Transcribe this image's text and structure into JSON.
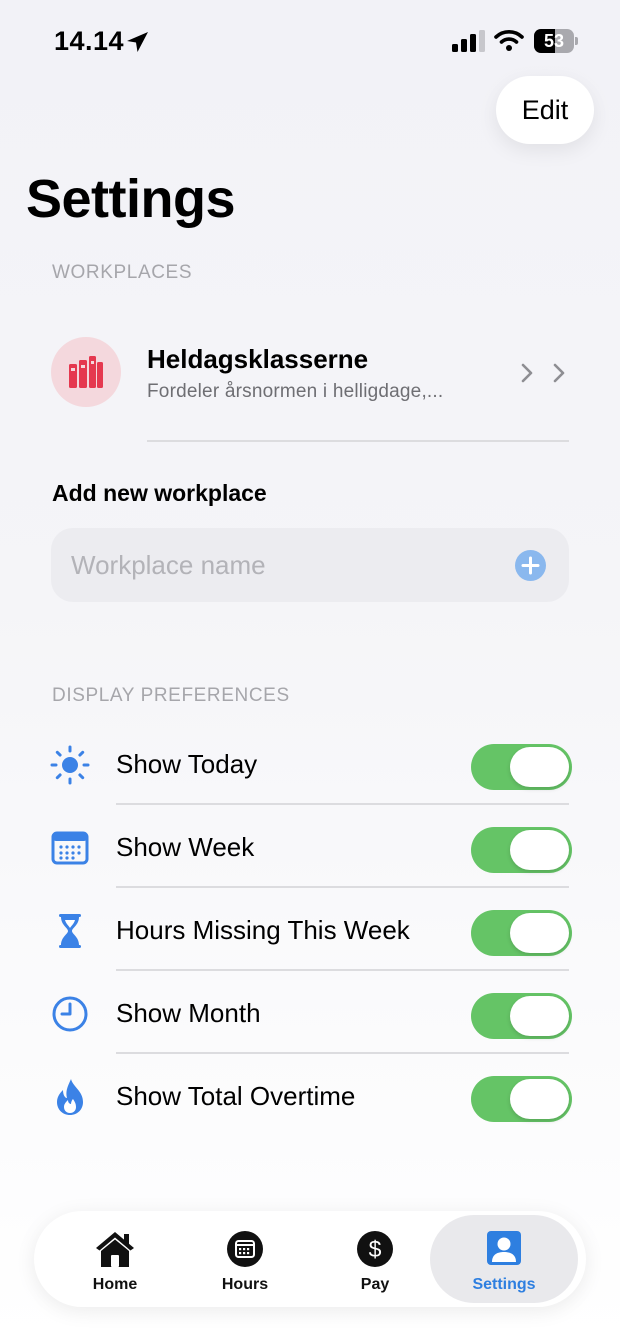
{
  "status_bar": {
    "time": "14.14",
    "battery": "53",
    "battery_level": 0.53
  },
  "header": {
    "edit_label": "Edit",
    "title": "Settings"
  },
  "workplaces": {
    "section_title": "WORKPLACES",
    "items": [
      {
        "name": "Heldagsklasserne",
        "subtitle": "Fordeler årsnormen i helligdage,...",
        "icon": "books-icon",
        "icon_color": "#e5384f"
      }
    ],
    "add_label": "Add new workplace",
    "input_placeholder": "Workplace name",
    "input_value": ""
  },
  "display_preferences": {
    "section_title": "DISPLAY PREFERENCES",
    "items": [
      {
        "label": "Show Today",
        "icon": "sun-icon",
        "enabled": true
      },
      {
        "label": "Show Week",
        "icon": "calendar-icon",
        "enabled": true
      },
      {
        "label": "Hours Missing This Week",
        "icon": "hourglass-icon",
        "enabled": true
      },
      {
        "label": "Show Month",
        "icon": "clock-icon",
        "enabled": true
      },
      {
        "label": "Show Total Overtime",
        "icon": "flame-icon",
        "enabled": true
      }
    ]
  },
  "tab_bar": {
    "tabs": [
      {
        "label": "Home",
        "icon": "house-icon",
        "active": false
      },
      {
        "label": "Hours",
        "icon": "calendar-circle-icon",
        "active": false
      },
      {
        "label": "Pay",
        "icon": "dollar-circle-icon",
        "active": false
      },
      {
        "label": "Settings",
        "icon": "person-square-icon",
        "active": true
      }
    ]
  },
  "colors": {
    "accent": "#2e7fe0",
    "toggle_on": "#65c466",
    "icon_blue": "#3b82e6",
    "section_header": "#a6a6ab"
  }
}
